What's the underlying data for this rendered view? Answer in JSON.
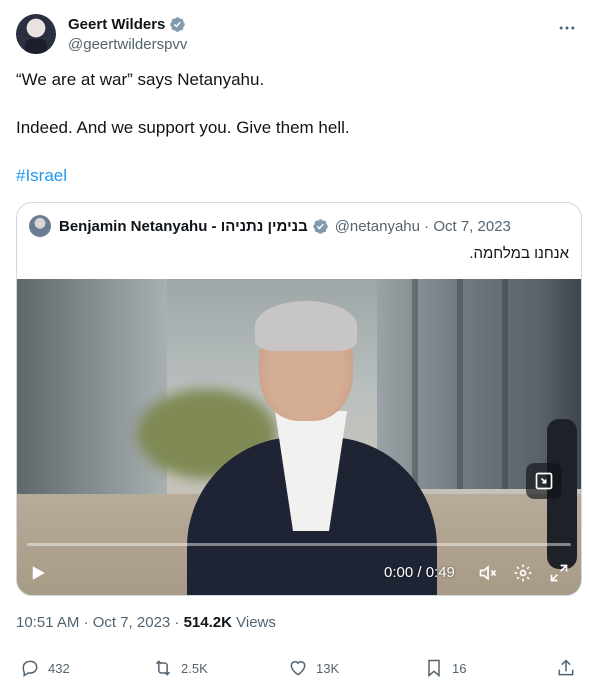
{
  "author": {
    "name": "Geert Wilders",
    "handle": "@geertwilderspvv"
  },
  "tweet": {
    "line1": "“We are at war” says Netanyahu.",
    "line2": "Indeed. And we support you. Give them hell.",
    "hashtag": "#Israel"
  },
  "quoted": {
    "name": "Benjamin Netanyahu - בנימין נתניהו",
    "handle_date": "@netanyahu · Oct 7, 2023",
    "text": "אנחנו במלחמה."
  },
  "video": {
    "time": "0:00 / 0:49",
    "progress": 0.0
  },
  "meta": {
    "time_date": "10:51 AM · Oct 7, 2023 · ",
    "views_count": "514.2K",
    "views_label": " Views"
  },
  "actions": {
    "replies": "432",
    "reposts": "2.5K",
    "likes": "13K",
    "bookmarks": "16"
  },
  "colors": {
    "accent": "#1d9bf0",
    "text": "#0f1419",
    "muted": "#536471",
    "border": "#cfd9de"
  },
  "icons": [
    "verified-icon",
    "more-icon",
    "play-icon",
    "volume-icon",
    "settings-icon",
    "fullscreen-icon",
    "pip-icon",
    "reply-icon",
    "repost-icon",
    "like-icon",
    "bookmark-icon",
    "share-icon"
  ]
}
